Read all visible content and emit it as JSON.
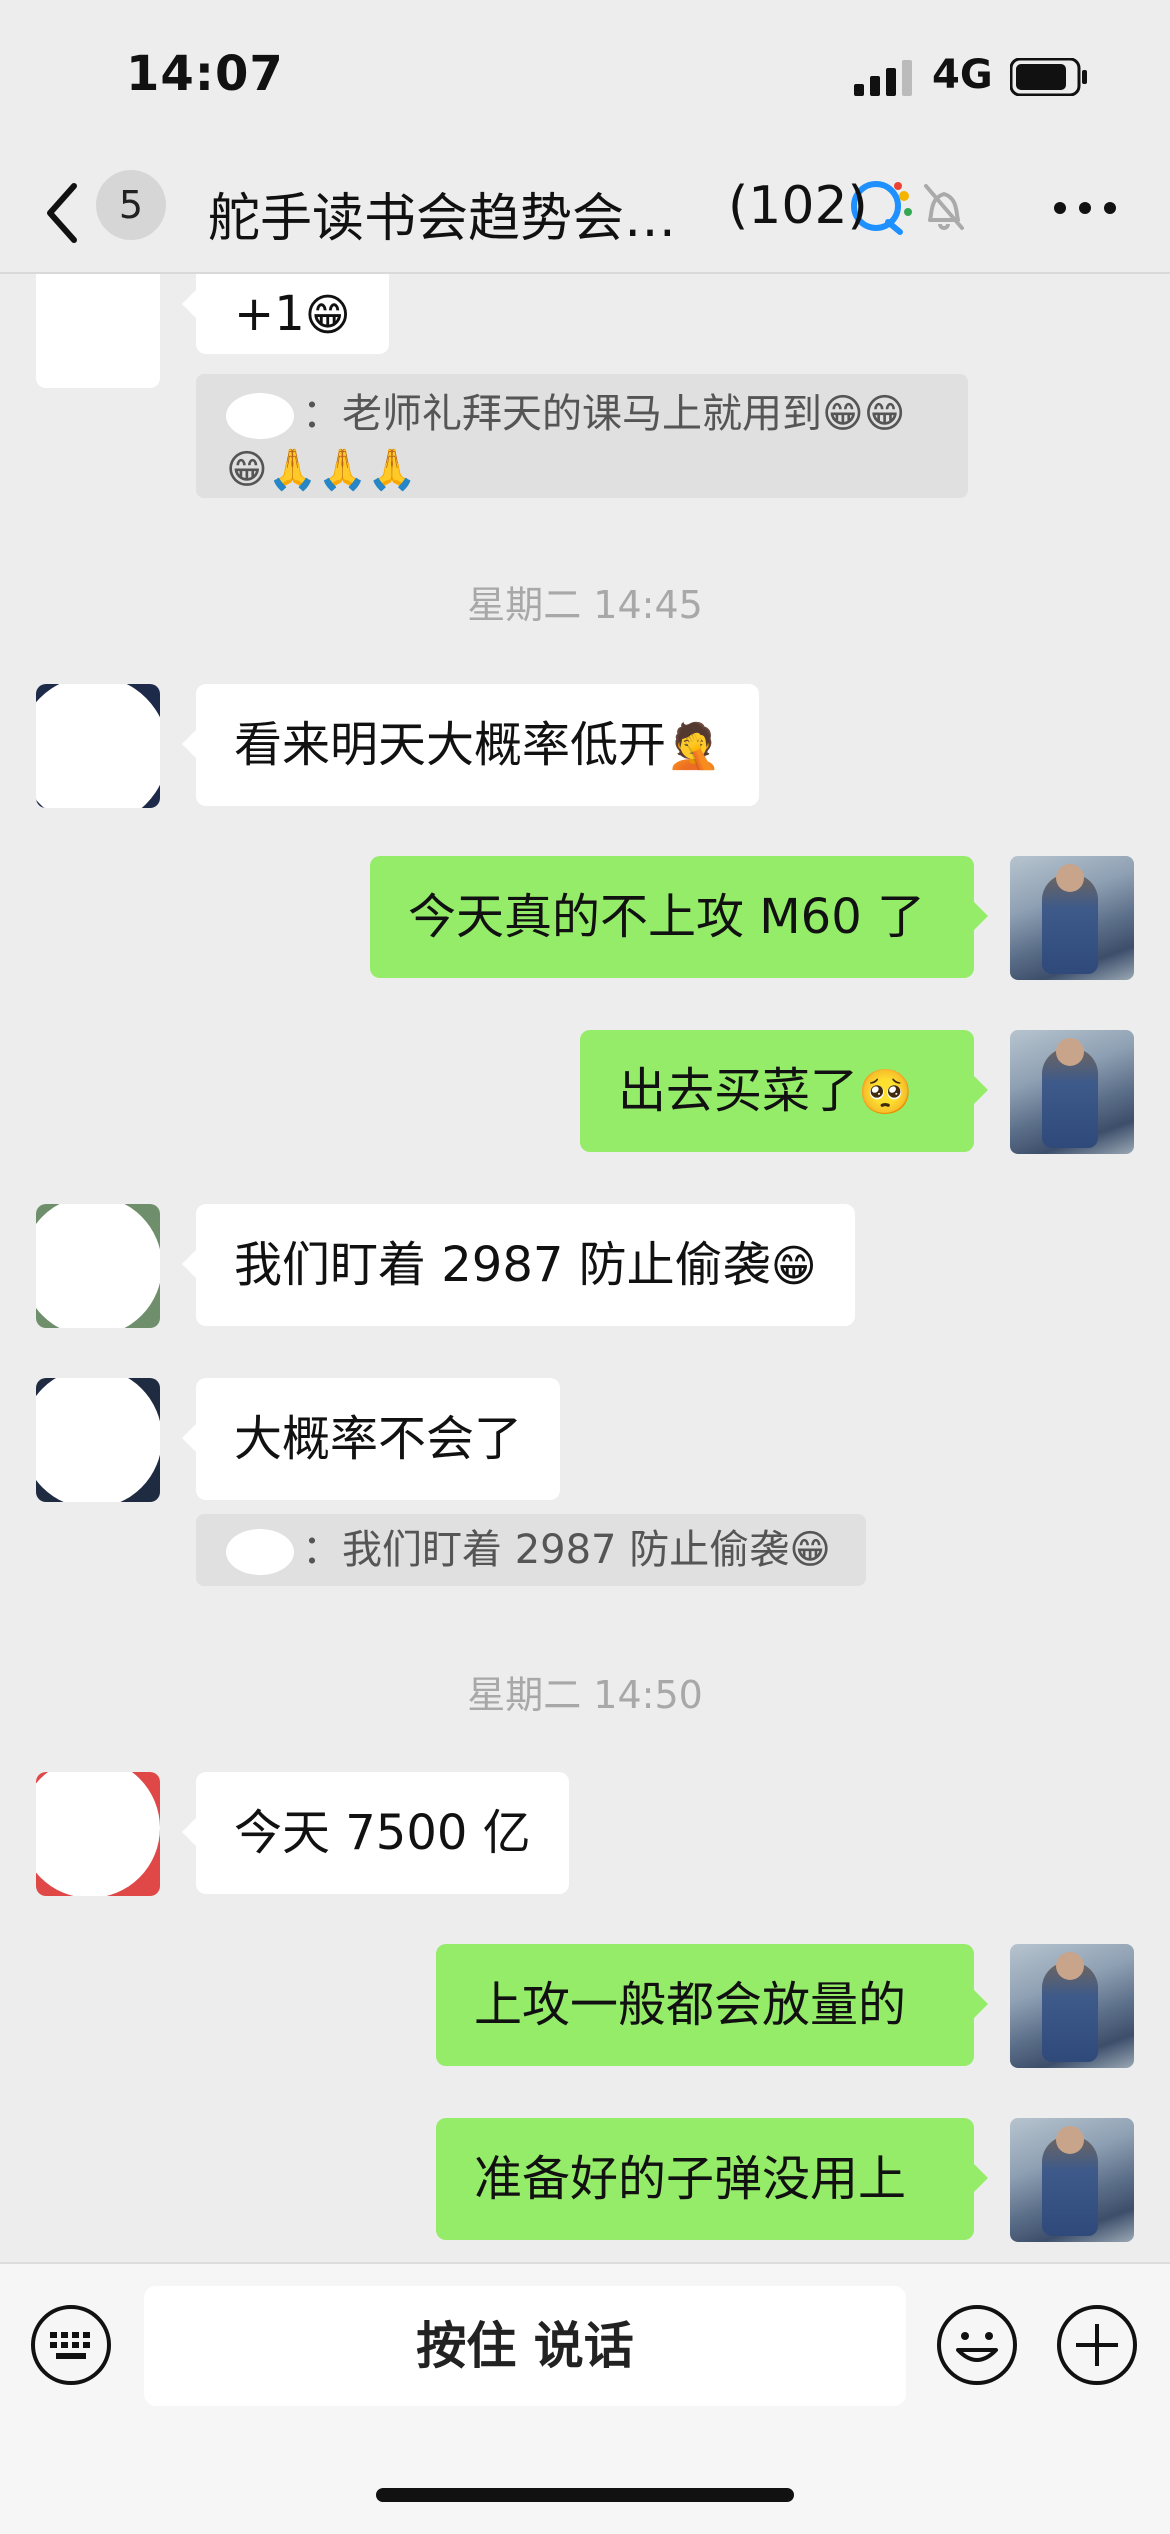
{
  "status_bar": {
    "time": "14:07",
    "network": "4G"
  },
  "nav": {
    "back_badge": "5",
    "title": "舵手读书会趋势会…",
    "member_count": "(102)"
  },
  "messages": [
    {
      "side": "in",
      "text": "+1",
      "emoji": "😁"
    },
    {
      "side": "quote",
      "text": "：老师礼拜天的课马上就用到😁😁😁🙏🙏🙏"
    },
    {
      "side": "time",
      "text": "星期二 14:45"
    },
    {
      "side": "in",
      "text": "看来明天大概率低开",
      "emoji": "🤦"
    },
    {
      "side": "out",
      "text": "今天真的不上攻 M60 了"
    },
    {
      "side": "out",
      "text": "出去买菜了",
      "emoji": "🥺"
    },
    {
      "side": "in",
      "text": "我们盯着 2987 防止偷袭",
      "emoji": "😁"
    },
    {
      "side": "in",
      "text": "大概率不会了"
    },
    {
      "side": "quote",
      "text": "：我们盯着 2987 防止偷袭😁"
    },
    {
      "side": "time",
      "text": "星期二 14:50"
    },
    {
      "side": "in",
      "text": "今天 7500 亿"
    },
    {
      "side": "out",
      "text": "上攻一般都会放量的"
    },
    {
      "side": "out",
      "text": "准备好的子弹没用上"
    }
  ],
  "input_bar": {
    "hold_to_talk": "按住 说话"
  },
  "icons": [
    "back-icon",
    "signal-icon",
    "battery-icon",
    "chat-ai-icon",
    "mute-bell-icon",
    "more-icon",
    "keyboard-icon",
    "emoji-icon",
    "plus-icon"
  ],
  "colors": {
    "background": "#ededed",
    "bubble_out": "#95ec69",
    "bubble_in": "#ffffff"
  }
}
